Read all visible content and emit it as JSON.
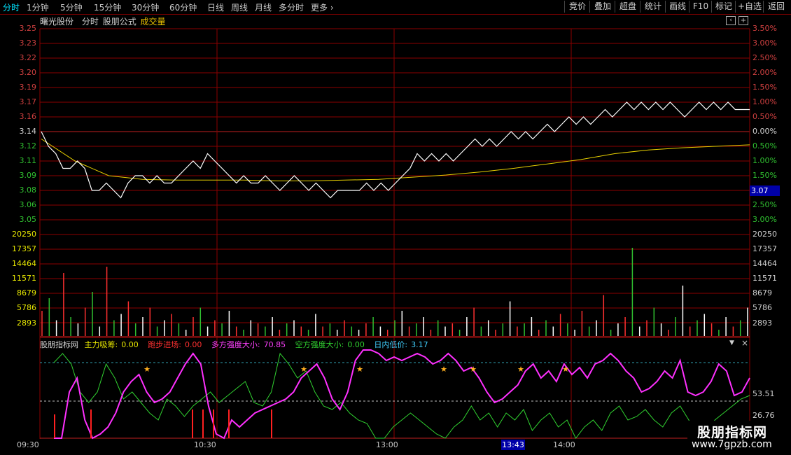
{
  "toolbar": {
    "period_tabs": [
      "分时",
      "1分钟",
      "5分钟",
      "15分钟",
      "30分钟",
      "60分钟",
      "日线",
      "周线",
      "月线",
      "多分时",
      "更多"
    ],
    "right_buttons": [
      "竞价",
      "叠加",
      "超盘",
      "统计",
      "画线",
      "F10",
      "标记",
      "+自选",
      "返回"
    ]
  },
  "header": {
    "stock_name": "曙光股份",
    "mode": "分时",
    "formula": "股朋公式",
    "volume_label": "成交量"
  },
  "price_axis": {
    "left_labels": [
      "3.25",
      "3.23",
      "3.22",
      "3.20",
      "3.19",
      "3.17",
      "3.16",
      "3.14",
      "3.12",
      "3.11",
      "3.09",
      "3.08",
      "3.06",
      "3.05"
    ],
    "right_labels": [
      "3.50%",
      "3.00%",
      "2.50%",
      "2.00%",
      "1.50%",
      "1.00%",
      "0.50%",
      "0.00%",
      "0.50%",
      "1.00%",
      "1.50%",
      "2.00%",
      "2.50%",
      "3.00%"
    ],
    "current_price_tag": "3.07",
    "prev_close": 3.14
  },
  "volume_axis": {
    "labels": [
      "20250",
      "17357",
      "14464",
      "11571",
      "8679",
      "5786",
      "2893"
    ]
  },
  "indicator": {
    "name": "股朋指标网",
    "items": [
      {
        "label": "主力吸筹:",
        "value": "0.00",
        "color": "#e8e800"
      },
      {
        "label": "跑步进场:",
        "value": "0.00",
        "color": "#ff3030"
      },
      {
        "label": "多方强度大小:",
        "value": "70.85",
        "color": "#ff40ff"
      },
      {
        "label": "空方强度大小:",
        "value": "0.00",
        "color": "#30d030"
      },
      {
        "label": "日内低价:",
        "value": "3.17",
        "color": "#40d0ff"
      }
    ],
    "axis_labels": [
      "53.51",
      "26.76"
    ]
  },
  "time_axis": {
    "labels": [
      "09:30",
      "10:30",
      "13:00",
      "14:00"
    ],
    "cursor_time": "13:43"
  },
  "watermark": {
    "title": "股朋指标网",
    "url": "www.7gpzb.com"
  },
  "colors": {
    "grid": "#8b0000",
    "price_line": "#ffffff",
    "avg_line": "#e8d000",
    "up": "#ff3030",
    "down": "#30c030",
    "flat": "#ffffff",
    "bull": "#ff30ff",
    "bear": "#30d030",
    "accent": "#00e4ff"
  },
  "chart_data": {
    "type": "line",
    "x": [
      "09:30",
      "10:30",
      "13:00",
      "14:00",
      "15:00"
    ],
    "series": [
      {
        "name": "",
        "values": [
          3.14,
          3.12,
          3.11,
          3.09,
          3.09,
          3.1,
          3.09,
          3.06,
          3.06,
          3.07,
          3.06,
          3.05,
          3.07,
          3.08,
          3.08,
          3.07,
          3.08,
          3.07,
          3.07,
          3.08,
          3.09,
          3.1,
          3.09,
          3.11,
          3.1,
          3.09,
          3.08,
          3.07,
          3.08,
          3.07,
          3.07,
          3.08,
          3.07,
          3.06,
          3.07,
          3.08,
          3.07,
          3.06,
          3.07,
          3.06,
          3.05,
          3.06,
          3.06,
          3.06,
          3.06,
          3.07,
          3.06,
          3.07,
          3.06,
          3.07,
          3.08,
          3.09,
          3.11,
          3.1,
          3.11,
          3.1,
          3.11,
          3.1,
          3.11,
          3.12,
          3.13,
          3.12,
          3.13,
          3.12,
          3.13,
          3.14,
          3.13,
          3.14,
          3.13,
          3.14,
          3.15,
          3.14,
          3.15,
          3.16,
          3.15,
          3.16,
          3.15,
          3.16,
          3.17,
          3.16,
          3.17,
          3.18,
          3.17,
          3.18,
          3.17,
          3.18,
          3.17,
          3.18,
          3.17,
          3.16,
          3.17,
          3.18,
          3.17,
          3.18,
          3.17,
          3.18,
          3.17,
          3.17,
          3.17
        ]
      },
      {
        "name": "",
        "values": [
          3.13,
          3.1,
          3.08,
          3.075,
          3.074,
          3.074,
          3.074,
          3.073,
          3.073,
          3.074,
          3.075,
          3.078,
          3.081,
          3.085,
          3.09,
          3.096,
          3.102,
          3.11,
          3.115,
          3.118,
          3.12,
          3.122
        ]
      }
    ],
    "volume_bars": [
      8,
      12,
      5,
      20,
      6,
      4,
      9,
      14,
      3,
      22,
      5,
      7,
      11,
      4,
      6,
      9,
      3,
      5,
      7,
      4,
      2,
      6,
      9,
      3,
      5,
      4,
      8,
      3,
      2,
      5,
      4,
      3,
      6,
      2,
      4,
      5,
      3,
      2,
      7,
      3,
      4,
      2,
      5,
      3,
      2,
      4,
      6,
      3,
      2,
      5,
      8,
      3,
      4,
      6,
      2,
      5,
      3,
      4,
      2,
      6,
      9,
      3,
      5,
      2,
      4,
      11,
      3,
      4,
      6,
      2,
      5,
      3,
      7,
      4,
      2,
      8,
      3,
      5,
      13,
      2,
      4,
      6,
      28,
      3,
      5,
      9,
      4,
      2,
      6,
      16,
      3,
      5,
      7,
      4,
      2,
      6,
      3,
      5,
      9
    ]
  }
}
